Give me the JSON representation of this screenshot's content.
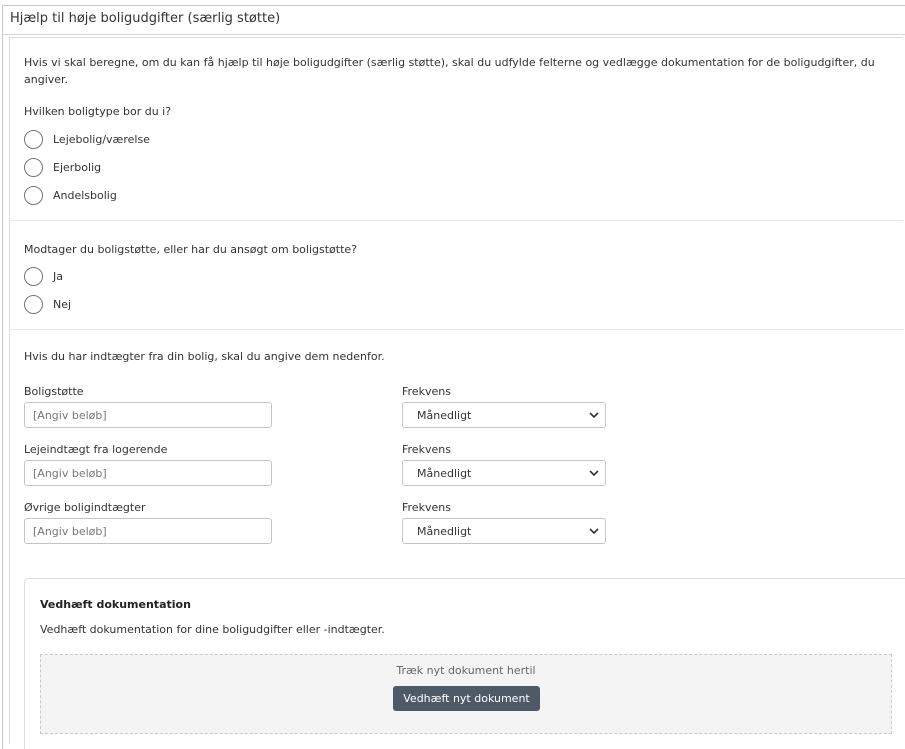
{
  "panel": {
    "title": "Hjælp til høje boligudgifter (særlig støtte)"
  },
  "intro": {
    "text": "Hvis vi skal beregne, om du kan få hjælp til høje boligudgifter (særlig støtte), skal du udfylde felterne og vedlægge dokumentation for de boligudgifter, du angiver."
  },
  "housing_type": {
    "question": "Hvilken boligtype bor du i?",
    "options": [
      {
        "label": "Lejebolig/værelse",
        "selected": false
      },
      {
        "label": "Ejerbolig",
        "selected": false
      },
      {
        "label": "Andelsbolig",
        "selected": false
      }
    ]
  },
  "housing_support": {
    "question": "Modtager du boligstøtte, eller har du ansøgt om boligstøtte?",
    "options": [
      {
        "label": "Ja",
        "selected": false
      },
      {
        "label": "Nej",
        "selected": false
      }
    ]
  },
  "income": {
    "intro": "Hvis du har indtægter fra din bolig, skal du angive dem nedenfor.",
    "rows": [
      {
        "label": "Boligstøtte",
        "placeholder": "[Angiv beløb]",
        "value": "",
        "frequency_label": "Frekvens",
        "frequency_value": "Månedligt"
      },
      {
        "label": "Lejeindtægt fra logerende",
        "placeholder": "[Angiv beløb]",
        "value": "",
        "frequency_label": "Frekvens",
        "frequency_value": "Månedligt"
      },
      {
        "label": "Øvrige boligindtægter",
        "placeholder": "[Angiv beløb]",
        "value": "",
        "frequency_label": "Frekvens",
        "frequency_value": "Månedligt"
      }
    ]
  },
  "documentation": {
    "title": "Vedhæft dokumentation",
    "description": "Vedhæft dokumentation for dine boligudgifter eller -indtægter.",
    "dropzone_text": "Træk nyt dokument hertil",
    "button_label": "Vedhæft nyt dokument"
  },
  "colors": {
    "button_bg": "#4f5a67",
    "dropzone_bg": "#f4f4f4",
    "border": "#c4c4c4"
  },
  "icons": {
    "select_chevron": "chevron-down-icon"
  }
}
